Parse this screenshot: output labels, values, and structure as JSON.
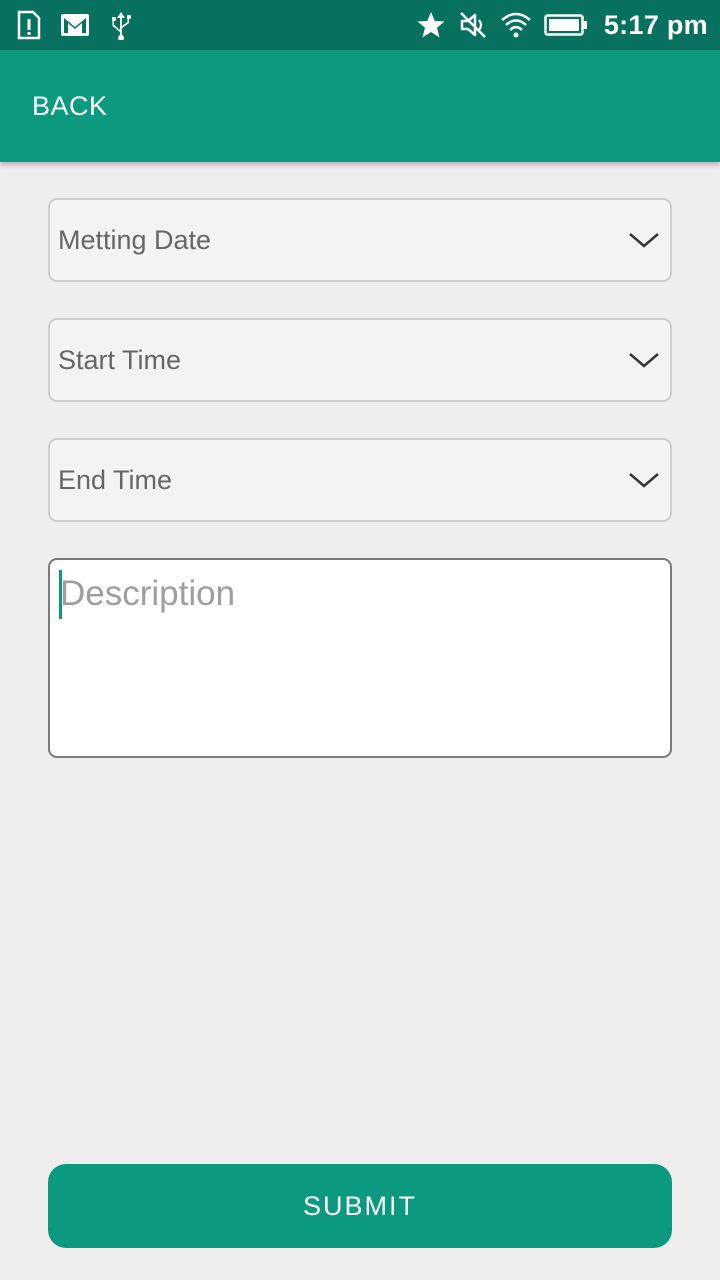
{
  "status_bar": {
    "time": "5:17 pm",
    "left_icons": [
      "alert-sim-icon",
      "gmail-icon",
      "usb-icon"
    ],
    "right_icons": [
      "star-icon",
      "mute-icon",
      "wifi-icon",
      "battery-icon"
    ],
    "background_color": "#08705e"
  },
  "app_bar": {
    "back_label": "BACK",
    "background_color": "#0b997f"
  },
  "form": {
    "meeting_date": {
      "label": "Metting Date",
      "icon": "chevron-down-icon"
    },
    "start_time": {
      "label": "Start Time",
      "icon": "chevron-down-icon"
    },
    "end_time": {
      "label": "End Time",
      "icon": "chevron-down-icon"
    },
    "description": {
      "placeholder": "Description",
      "value": ""
    },
    "submit_label": "SUBMIT"
  },
  "colors": {
    "accent": "#0b997f",
    "page_background": "#eeeeee"
  }
}
